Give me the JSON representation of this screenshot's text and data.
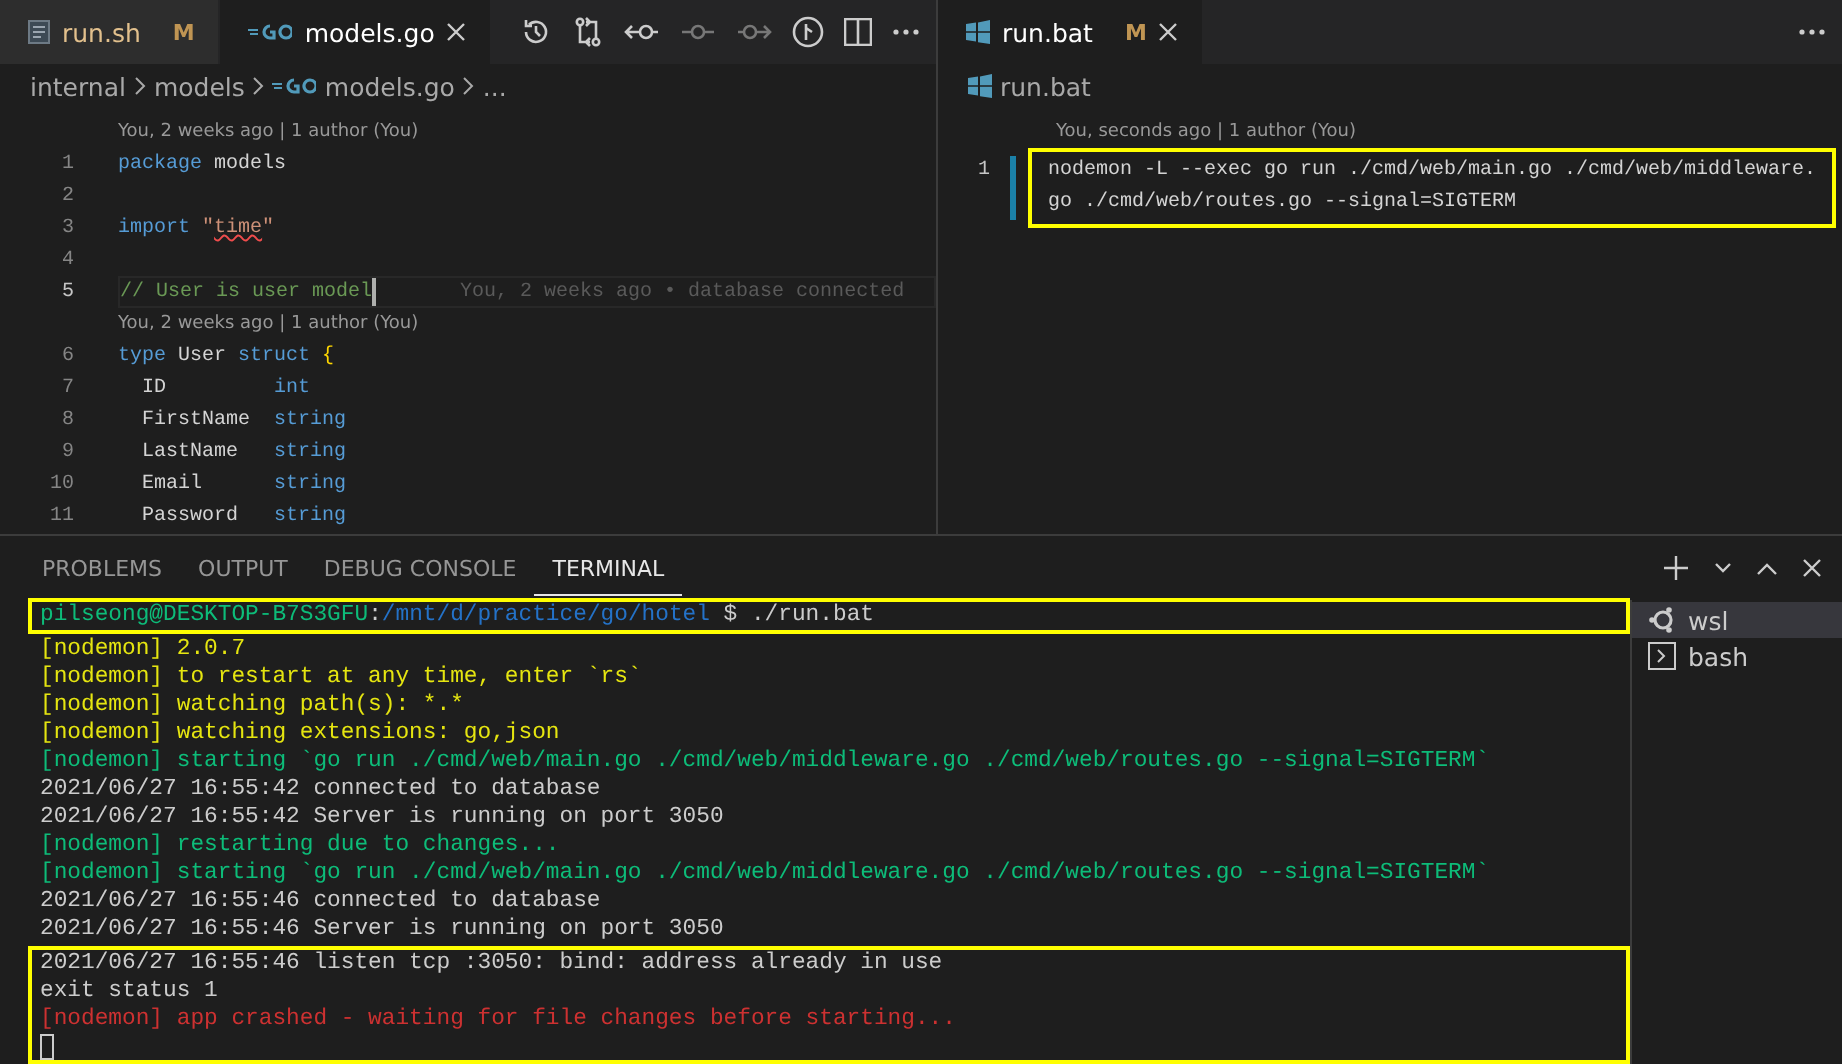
{
  "left_editor": {
    "tabs": [
      {
        "label": "run.sh",
        "badge": "M",
        "kind": "shell-file",
        "selected": false
      },
      {
        "label": "models.go",
        "kind": "go-file",
        "selected": true
      }
    ],
    "breadcrumb": [
      {
        "text": "internal",
        "kind": "folder"
      },
      {
        "text": "models",
        "kind": "folder"
      },
      {
        "text": "models.go",
        "kind": "go-file"
      },
      {
        "text": "...",
        "kind": "ellipsis"
      }
    ],
    "lines": [
      {
        "kind": "codelens",
        "text": "You, 2 weeks ago | 1 author (You)"
      },
      {
        "kind": "code",
        "number": "1",
        "current": false,
        "segments": [
          {
            "text": "package",
            "kind": "keyword"
          },
          {
            "text": " models",
            "kind": "plain"
          }
        ]
      },
      {
        "kind": "code",
        "number": "2",
        "current": false
      },
      {
        "kind": "code",
        "number": "3",
        "current": false,
        "segments": [
          {
            "text": "import",
            "kind": "keyword"
          },
          {
            "text": " \"",
            "kind": "string"
          },
          {
            "text": "time",
            "kind": "error"
          },
          {
            "text": "\"",
            "kind": "string"
          }
        ]
      },
      {
        "kind": "code",
        "number": "4",
        "current": false
      },
      {
        "kind": "code",
        "number": "5",
        "current": true,
        "segments": [
          {
            "text": "// User is user model",
            "kind": "comment"
          }
        ],
        "blame": "You, 2 weeks ago • database connected"
      },
      {
        "kind": "codelens",
        "text": "You, 2 weeks ago | 1 author (You)"
      },
      {
        "kind": "code",
        "number": "6",
        "current": false,
        "segments": [
          {
            "text": "type",
            "kind": "keyword"
          },
          {
            "text": " User ",
            "kind": "plain"
          },
          {
            "text": "struct",
            "kind": "keyword"
          },
          {
            "text": " {",
            "kind": "brace"
          }
        ]
      },
      {
        "kind": "code",
        "number": "7",
        "current": false,
        "segments": [
          {
            "text": "  ID         ",
            "kind": "plain"
          },
          {
            "text": "int",
            "kind": "keyword"
          }
        ]
      },
      {
        "kind": "code",
        "number": "8",
        "current": false,
        "segments": [
          {
            "text": "  FirstName  ",
            "kind": "plain"
          },
          {
            "text": "string",
            "kind": "keyword"
          }
        ]
      },
      {
        "kind": "code",
        "number": "9",
        "current": false,
        "segments": [
          {
            "text": "  LastName   ",
            "kind": "plain"
          },
          {
            "text": "string",
            "kind": "keyword"
          }
        ]
      },
      {
        "kind": "code",
        "number": "10",
        "current": false,
        "segments": [
          {
            "text": "  Email      ",
            "kind": "plain"
          },
          {
            "text": "string",
            "kind": "keyword"
          }
        ]
      },
      {
        "kind": "code",
        "number": "11",
        "current": false,
        "segments": [
          {
            "text": "  Password   ",
            "kind": "plain"
          },
          {
            "text": "string",
            "kind": "keyword"
          }
        ]
      }
    ]
  },
  "right_editor": {
    "tabs": [
      {
        "label": "run.bat",
        "badge": "M",
        "kind": "batch-file",
        "selected": true
      }
    ],
    "breadcrumb": [
      {
        "text": "run.bat",
        "kind": "batch-file"
      }
    ],
    "lines": [
      {
        "kind": "codelens",
        "text": "You, seconds ago | 1 author (You)"
      },
      {
        "kind": "wrapped",
        "number": "1",
        "current": true,
        "highlighted": true,
        "rows": [
          "nodemon -L --exec go run ./cmd/web/main.go ./cmd/web/middleware.",
          "go ./cmd/web/routes.go --signal=SIGTERM"
        ]
      }
    ]
  },
  "panel": {
    "tabs": [
      {
        "label": "PROBLEMS",
        "selected": false
      },
      {
        "label": "OUTPUT",
        "selected": false
      },
      {
        "label": "DEBUG CONSOLE",
        "selected": false
      },
      {
        "label": "TERMINAL",
        "selected": true
      }
    ],
    "blocks": [
      {
        "highlighted": true,
        "cursor": false,
        "lines": [
          {
            "kind": "prompt",
            "user": "pilseong@DESKTOP-B7S3GFU",
            "separator": ":",
            "path": "/mnt/d/practice/go/hotel",
            "command": "$ ./run.bat"
          }
        ]
      },
      {
        "highlighted": false,
        "cursor": false,
        "lines": [
          {
            "kind": "info",
            "text": "[nodemon] 2.0.7"
          },
          {
            "kind": "info",
            "text": "[nodemon] to restart at any time, enter `rs`"
          },
          {
            "kind": "info",
            "text": "[nodemon] watching path(s): *.*"
          },
          {
            "kind": "info",
            "text": "[nodemon] watching extensions: go,json"
          },
          {
            "kind": "status",
            "text": "[nodemon] starting `go run ./cmd/web/main.go ./cmd/web/middleware.go ./cmd/web/routes.go --signal=SIGTERM`"
          },
          {
            "kind": "plain",
            "text": "2021/06/27 16:55:42 connected to database"
          },
          {
            "kind": "plain",
            "text": "2021/06/27 16:55:42 Server is running on port 3050"
          },
          {
            "kind": "status",
            "text": "[nodemon] restarting due to changes..."
          },
          {
            "kind": "status",
            "text": "[nodemon] starting `go run ./cmd/web/main.go ./cmd/web/middleware.go ./cmd/web/routes.go --signal=SIGTERM`"
          },
          {
            "kind": "plain",
            "text": "2021/06/27 16:55:46 connected to database"
          },
          {
            "kind": "plain",
            "text": "2021/06/27 16:55:46 Server is running on port 3050"
          }
        ]
      },
      {
        "highlighted": true,
        "cursor": true,
        "lines": [
          {
            "kind": "plain",
            "text": "2021/06/27 16:55:46 listen tcp :3050: bind: address already in use"
          },
          {
            "kind": "plain",
            "text": "exit status 1"
          },
          {
            "kind": "error",
            "text": "[nodemon] app crashed - waiting for file changes before starting..."
          }
        ]
      }
    ],
    "terminals": [
      {
        "label": "wsl",
        "kind": "ubuntu",
        "selected": true
      },
      {
        "label": "bash",
        "kind": "shell",
        "selected": false
      }
    ]
  }
}
